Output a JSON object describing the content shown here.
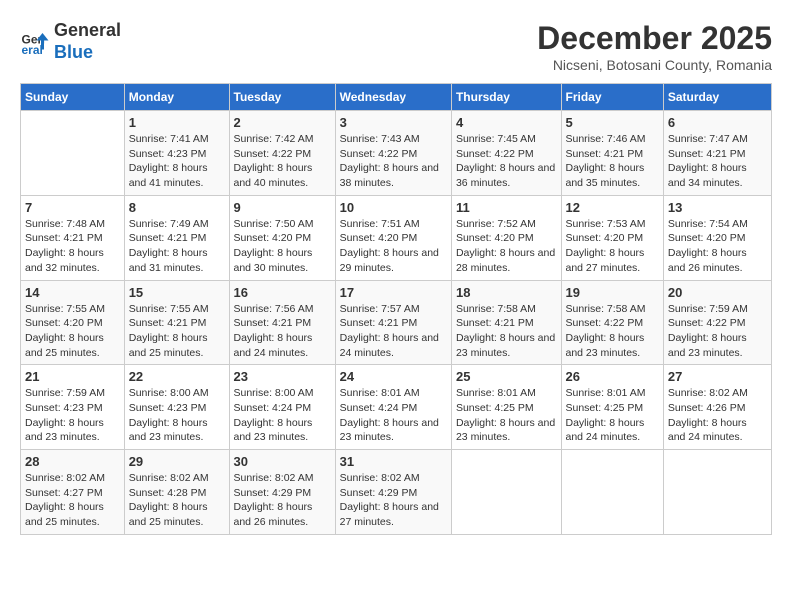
{
  "logo": {
    "line1": "General",
    "line2": "Blue"
  },
  "title": "December 2025",
  "subtitle": "Nicseni, Botosani County, Romania",
  "days_of_week": [
    "Sunday",
    "Monday",
    "Tuesday",
    "Wednesday",
    "Thursday",
    "Friday",
    "Saturday"
  ],
  "weeks": [
    [
      {
        "day": "",
        "sunrise": "",
        "sunset": "",
        "daylight": ""
      },
      {
        "day": "1",
        "sunrise": "Sunrise: 7:41 AM",
        "sunset": "Sunset: 4:23 PM",
        "daylight": "Daylight: 8 hours and 41 minutes."
      },
      {
        "day": "2",
        "sunrise": "Sunrise: 7:42 AM",
        "sunset": "Sunset: 4:22 PM",
        "daylight": "Daylight: 8 hours and 40 minutes."
      },
      {
        "day": "3",
        "sunrise": "Sunrise: 7:43 AM",
        "sunset": "Sunset: 4:22 PM",
        "daylight": "Daylight: 8 hours and 38 minutes."
      },
      {
        "day": "4",
        "sunrise": "Sunrise: 7:45 AM",
        "sunset": "Sunset: 4:22 PM",
        "daylight": "Daylight: 8 hours and 36 minutes."
      },
      {
        "day": "5",
        "sunrise": "Sunrise: 7:46 AM",
        "sunset": "Sunset: 4:21 PM",
        "daylight": "Daylight: 8 hours and 35 minutes."
      },
      {
        "day": "6",
        "sunrise": "Sunrise: 7:47 AM",
        "sunset": "Sunset: 4:21 PM",
        "daylight": "Daylight: 8 hours and 34 minutes."
      }
    ],
    [
      {
        "day": "7",
        "sunrise": "Sunrise: 7:48 AM",
        "sunset": "Sunset: 4:21 PM",
        "daylight": "Daylight: 8 hours and 32 minutes."
      },
      {
        "day": "8",
        "sunrise": "Sunrise: 7:49 AM",
        "sunset": "Sunset: 4:21 PM",
        "daylight": "Daylight: 8 hours and 31 minutes."
      },
      {
        "day": "9",
        "sunrise": "Sunrise: 7:50 AM",
        "sunset": "Sunset: 4:20 PM",
        "daylight": "Daylight: 8 hours and 30 minutes."
      },
      {
        "day": "10",
        "sunrise": "Sunrise: 7:51 AM",
        "sunset": "Sunset: 4:20 PM",
        "daylight": "Daylight: 8 hours and 29 minutes."
      },
      {
        "day": "11",
        "sunrise": "Sunrise: 7:52 AM",
        "sunset": "Sunset: 4:20 PM",
        "daylight": "Daylight: 8 hours and 28 minutes."
      },
      {
        "day": "12",
        "sunrise": "Sunrise: 7:53 AM",
        "sunset": "Sunset: 4:20 PM",
        "daylight": "Daylight: 8 hours and 27 minutes."
      },
      {
        "day": "13",
        "sunrise": "Sunrise: 7:54 AM",
        "sunset": "Sunset: 4:20 PM",
        "daylight": "Daylight: 8 hours and 26 minutes."
      }
    ],
    [
      {
        "day": "14",
        "sunrise": "Sunrise: 7:55 AM",
        "sunset": "Sunset: 4:20 PM",
        "daylight": "Daylight: 8 hours and 25 minutes."
      },
      {
        "day": "15",
        "sunrise": "Sunrise: 7:55 AM",
        "sunset": "Sunset: 4:21 PM",
        "daylight": "Daylight: 8 hours and 25 minutes."
      },
      {
        "day": "16",
        "sunrise": "Sunrise: 7:56 AM",
        "sunset": "Sunset: 4:21 PM",
        "daylight": "Daylight: 8 hours and 24 minutes."
      },
      {
        "day": "17",
        "sunrise": "Sunrise: 7:57 AM",
        "sunset": "Sunset: 4:21 PM",
        "daylight": "Daylight: 8 hours and 24 minutes."
      },
      {
        "day": "18",
        "sunrise": "Sunrise: 7:58 AM",
        "sunset": "Sunset: 4:21 PM",
        "daylight": "Daylight: 8 hours and 23 minutes."
      },
      {
        "day": "19",
        "sunrise": "Sunrise: 7:58 AM",
        "sunset": "Sunset: 4:22 PM",
        "daylight": "Daylight: 8 hours and 23 minutes."
      },
      {
        "day": "20",
        "sunrise": "Sunrise: 7:59 AM",
        "sunset": "Sunset: 4:22 PM",
        "daylight": "Daylight: 8 hours and 23 minutes."
      }
    ],
    [
      {
        "day": "21",
        "sunrise": "Sunrise: 7:59 AM",
        "sunset": "Sunset: 4:23 PM",
        "daylight": "Daylight: 8 hours and 23 minutes."
      },
      {
        "day": "22",
        "sunrise": "Sunrise: 8:00 AM",
        "sunset": "Sunset: 4:23 PM",
        "daylight": "Daylight: 8 hours and 23 minutes."
      },
      {
        "day": "23",
        "sunrise": "Sunrise: 8:00 AM",
        "sunset": "Sunset: 4:24 PM",
        "daylight": "Daylight: 8 hours and 23 minutes."
      },
      {
        "day": "24",
        "sunrise": "Sunrise: 8:01 AM",
        "sunset": "Sunset: 4:24 PM",
        "daylight": "Daylight: 8 hours and 23 minutes."
      },
      {
        "day": "25",
        "sunrise": "Sunrise: 8:01 AM",
        "sunset": "Sunset: 4:25 PM",
        "daylight": "Daylight: 8 hours and 23 minutes."
      },
      {
        "day": "26",
        "sunrise": "Sunrise: 8:01 AM",
        "sunset": "Sunset: 4:25 PM",
        "daylight": "Daylight: 8 hours and 24 minutes."
      },
      {
        "day": "27",
        "sunrise": "Sunrise: 8:02 AM",
        "sunset": "Sunset: 4:26 PM",
        "daylight": "Daylight: 8 hours and 24 minutes."
      }
    ],
    [
      {
        "day": "28",
        "sunrise": "Sunrise: 8:02 AM",
        "sunset": "Sunset: 4:27 PM",
        "daylight": "Daylight: 8 hours and 25 minutes."
      },
      {
        "day": "29",
        "sunrise": "Sunrise: 8:02 AM",
        "sunset": "Sunset: 4:28 PM",
        "daylight": "Daylight: 8 hours and 25 minutes."
      },
      {
        "day": "30",
        "sunrise": "Sunrise: 8:02 AM",
        "sunset": "Sunset: 4:29 PM",
        "daylight": "Daylight: 8 hours and 26 minutes."
      },
      {
        "day": "31",
        "sunrise": "Sunrise: 8:02 AM",
        "sunset": "Sunset: 4:29 PM",
        "daylight": "Daylight: 8 hours and 27 minutes."
      },
      {
        "day": "",
        "sunrise": "",
        "sunset": "",
        "daylight": ""
      },
      {
        "day": "",
        "sunrise": "",
        "sunset": "",
        "daylight": ""
      },
      {
        "day": "",
        "sunrise": "",
        "sunset": "",
        "daylight": ""
      }
    ]
  ]
}
